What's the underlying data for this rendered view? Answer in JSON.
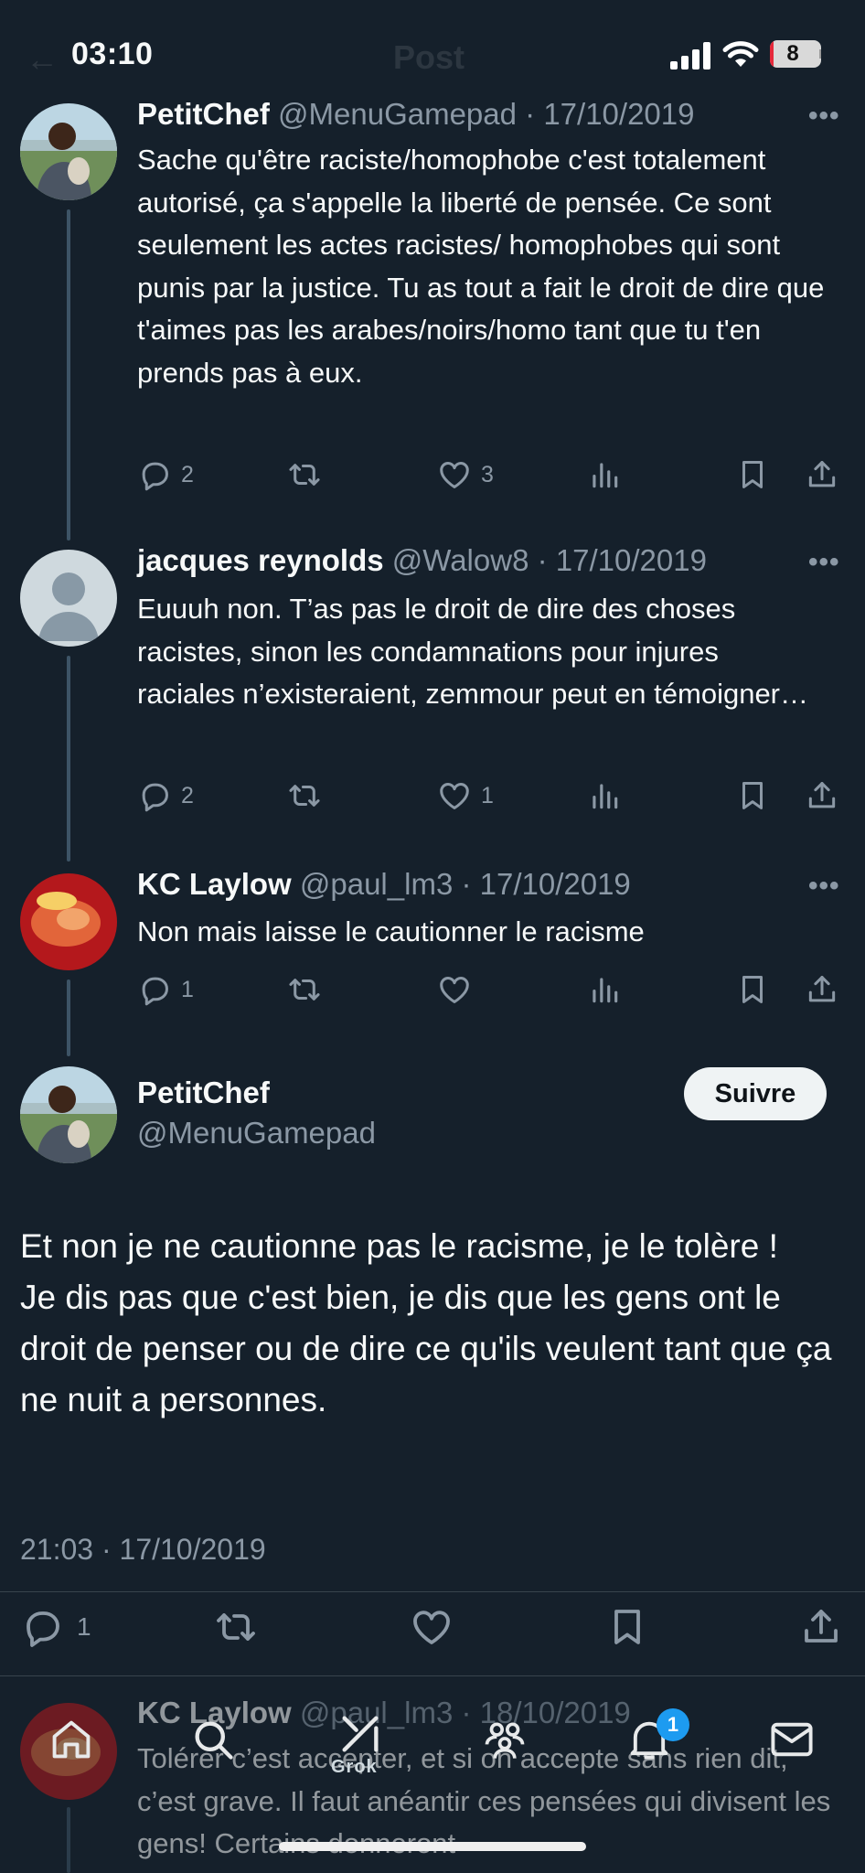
{
  "status_bar": {
    "time": "03:10",
    "battery_level": "8",
    "background_title": "Post"
  },
  "colors": {
    "background": "#15202b",
    "muted": "#8b98a5",
    "accent": "#1d9bf0",
    "thread_line": "#3d5466"
  },
  "replies_above": [
    {
      "name": "PetitChef",
      "handle": "@MenuGamepad",
      "date": "· 17/10/2019",
      "text": "Sache qu'être raciste/homophobe c'est totalement autorisé, ça s'appelle la liberté de pensée. Ce sont seulement les actes racistes/ homophobes qui sont punis par la justice. Tu as tout a fait le droit de dire que t'aimes pas les arabes/noirs/homo tant que tu t'en prends pas à eux.",
      "replies": "2",
      "likes": "3"
    },
    {
      "name": "jacques reynolds",
      "handle": "@Walow8",
      "date": "· 17/10/2019",
      "text": "Euuuh non. T’as pas le droit de dire des choses racistes, sinon les condamnations pour injures raciales n’existeraient, zemmour peut en témoigner…",
      "replies": "2",
      "likes": "1"
    },
    {
      "name": "KC Laylow",
      "handle": "@paul_lm3",
      "date": "· 17/10/2019",
      "text": "Non mais laisse le cautionner le racisme",
      "replies": "1",
      "likes": ""
    }
  ],
  "main_post": {
    "name": "PetitChef",
    "handle": "@MenuGamepad",
    "follow_label": "Suivre",
    "text": "Et non je ne cautionne pas le racisme, je le tolère !\nJe dis pas que c'est bien, je dis que les gens ont le droit de penser ou de dire ce qu'ils veulent tant que ça ne nuit a personnes.",
    "timestamp": "21:03 · 17/10/2019",
    "replies": "1"
  },
  "reply_below": {
    "name": "KC Laylow",
    "handle": "@paul_lm3",
    "date": "· 18/10/2019",
    "text": "Tolérer c’est accepter, et si on accepte sans rien dit, c’est grave. Il faut anéantir ces pensées qui divisent les gens! Certains donneront"
  },
  "tab_bar": {
    "items": [
      "home-icon",
      "search-icon",
      "grok-icon",
      "communities-icon",
      "notifications-icon",
      "messages-icon"
    ],
    "grok_label": "Grok",
    "notification_badge": "1"
  },
  "icons": [
    "reply-icon",
    "retweet-icon",
    "like-icon",
    "views-icon",
    "bookmark-icon",
    "share-icon",
    "more-icon"
  ]
}
